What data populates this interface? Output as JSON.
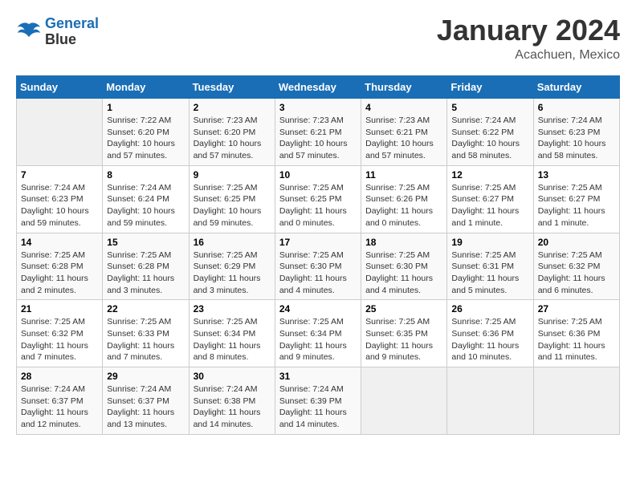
{
  "logo": {
    "line1": "General",
    "line2": "Blue"
  },
  "title": "January 2024",
  "location": "Acachuen, Mexico",
  "days_header": [
    "Sunday",
    "Monday",
    "Tuesday",
    "Wednesday",
    "Thursday",
    "Friday",
    "Saturday"
  ],
  "weeks": [
    [
      {
        "num": "",
        "detail": ""
      },
      {
        "num": "1",
        "detail": "Sunrise: 7:22 AM\nSunset: 6:20 PM\nDaylight: 10 hours\nand 57 minutes."
      },
      {
        "num": "2",
        "detail": "Sunrise: 7:23 AM\nSunset: 6:20 PM\nDaylight: 10 hours\nand 57 minutes."
      },
      {
        "num": "3",
        "detail": "Sunrise: 7:23 AM\nSunset: 6:21 PM\nDaylight: 10 hours\nand 57 minutes."
      },
      {
        "num": "4",
        "detail": "Sunrise: 7:23 AM\nSunset: 6:21 PM\nDaylight: 10 hours\nand 57 minutes."
      },
      {
        "num": "5",
        "detail": "Sunrise: 7:24 AM\nSunset: 6:22 PM\nDaylight: 10 hours\nand 58 minutes."
      },
      {
        "num": "6",
        "detail": "Sunrise: 7:24 AM\nSunset: 6:23 PM\nDaylight: 10 hours\nand 58 minutes."
      }
    ],
    [
      {
        "num": "7",
        "detail": "Sunrise: 7:24 AM\nSunset: 6:23 PM\nDaylight: 10 hours\nand 59 minutes."
      },
      {
        "num": "8",
        "detail": "Sunrise: 7:24 AM\nSunset: 6:24 PM\nDaylight: 10 hours\nand 59 minutes."
      },
      {
        "num": "9",
        "detail": "Sunrise: 7:25 AM\nSunset: 6:25 PM\nDaylight: 10 hours\nand 59 minutes."
      },
      {
        "num": "10",
        "detail": "Sunrise: 7:25 AM\nSunset: 6:25 PM\nDaylight: 11 hours\nand 0 minutes."
      },
      {
        "num": "11",
        "detail": "Sunrise: 7:25 AM\nSunset: 6:26 PM\nDaylight: 11 hours\nand 0 minutes."
      },
      {
        "num": "12",
        "detail": "Sunrise: 7:25 AM\nSunset: 6:27 PM\nDaylight: 11 hours\nand 1 minute."
      },
      {
        "num": "13",
        "detail": "Sunrise: 7:25 AM\nSunset: 6:27 PM\nDaylight: 11 hours\nand 1 minute."
      }
    ],
    [
      {
        "num": "14",
        "detail": "Sunrise: 7:25 AM\nSunset: 6:28 PM\nDaylight: 11 hours\nand 2 minutes."
      },
      {
        "num": "15",
        "detail": "Sunrise: 7:25 AM\nSunset: 6:28 PM\nDaylight: 11 hours\nand 3 minutes."
      },
      {
        "num": "16",
        "detail": "Sunrise: 7:25 AM\nSunset: 6:29 PM\nDaylight: 11 hours\nand 3 minutes."
      },
      {
        "num": "17",
        "detail": "Sunrise: 7:25 AM\nSunset: 6:30 PM\nDaylight: 11 hours\nand 4 minutes."
      },
      {
        "num": "18",
        "detail": "Sunrise: 7:25 AM\nSunset: 6:30 PM\nDaylight: 11 hours\nand 4 minutes."
      },
      {
        "num": "19",
        "detail": "Sunrise: 7:25 AM\nSunset: 6:31 PM\nDaylight: 11 hours\nand 5 minutes."
      },
      {
        "num": "20",
        "detail": "Sunrise: 7:25 AM\nSunset: 6:32 PM\nDaylight: 11 hours\nand 6 minutes."
      }
    ],
    [
      {
        "num": "21",
        "detail": "Sunrise: 7:25 AM\nSunset: 6:32 PM\nDaylight: 11 hours\nand 7 minutes."
      },
      {
        "num": "22",
        "detail": "Sunrise: 7:25 AM\nSunset: 6:33 PM\nDaylight: 11 hours\nand 7 minutes."
      },
      {
        "num": "23",
        "detail": "Sunrise: 7:25 AM\nSunset: 6:34 PM\nDaylight: 11 hours\nand 8 minutes."
      },
      {
        "num": "24",
        "detail": "Sunrise: 7:25 AM\nSunset: 6:34 PM\nDaylight: 11 hours\nand 9 minutes."
      },
      {
        "num": "25",
        "detail": "Sunrise: 7:25 AM\nSunset: 6:35 PM\nDaylight: 11 hours\nand 9 minutes."
      },
      {
        "num": "26",
        "detail": "Sunrise: 7:25 AM\nSunset: 6:36 PM\nDaylight: 11 hours\nand 10 minutes."
      },
      {
        "num": "27",
        "detail": "Sunrise: 7:25 AM\nSunset: 6:36 PM\nDaylight: 11 hours\nand 11 minutes."
      }
    ],
    [
      {
        "num": "28",
        "detail": "Sunrise: 7:24 AM\nSunset: 6:37 PM\nDaylight: 11 hours\nand 12 minutes."
      },
      {
        "num": "29",
        "detail": "Sunrise: 7:24 AM\nSunset: 6:37 PM\nDaylight: 11 hours\nand 13 minutes."
      },
      {
        "num": "30",
        "detail": "Sunrise: 7:24 AM\nSunset: 6:38 PM\nDaylight: 11 hours\nand 14 minutes."
      },
      {
        "num": "31",
        "detail": "Sunrise: 7:24 AM\nSunset: 6:39 PM\nDaylight: 11 hours\nand 14 minutes."
      },
      {
        "num": "",
        "detail": ""
      },
      {
        "num": "",
        "detail": ""
      },
      {
        "num": "",
        "detail": ""
      }
    ]
  ]
}
